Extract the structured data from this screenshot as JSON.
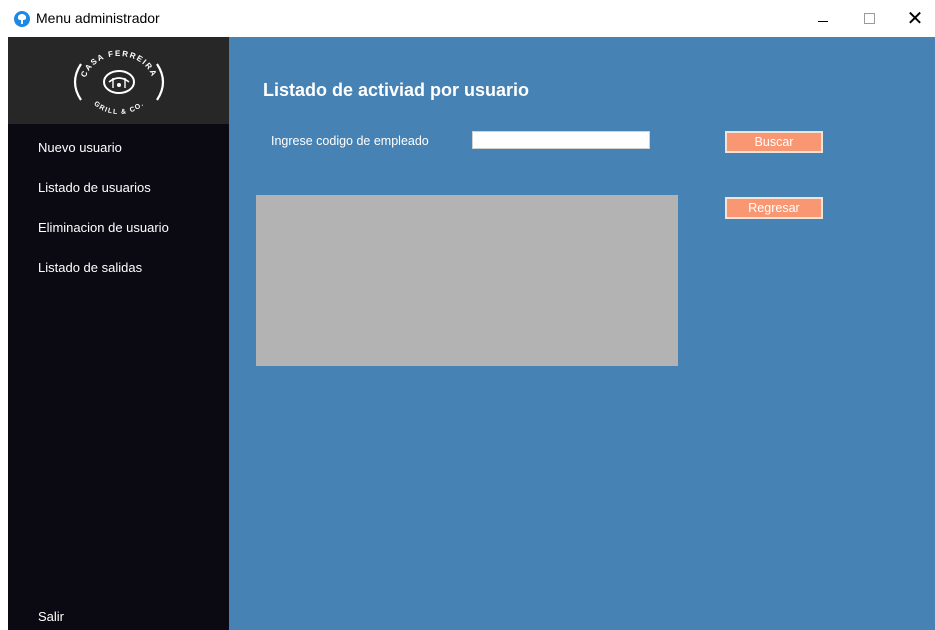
{
  "window": {
    "title": "Menu administrador",
    "icon": "app-icon"
  },
  "sidebar": {
    "logo": {
      "top_text": "CASA FERREIRA",
      "bottom_text": "GRILL & CO."
    },
    "items": [
      {
        "label": "Nuevo usuario"
      },
      {
        "label": "Listado de usuarios"
      },
      {
        "label": "Eliminacion de usuario"
      },
      {
        "label": "Listado de salidas"
      }
    ],
    "exit_label": "Salir"
  },
  "main": {
    "title": "Listado de activiad por usuario",
    "employee_label": "Ingrese codigo de empleado",
    "employee_input_value": "",
    "search_label": "Buscar",
    "back_label": "Regresar"
  },
  "colors": {
    "sidebar_bg": "#0b0a12",
    "logo_bg": "#272727",
    "main_bg": "#4682b4",
    "button_bg": "#fa9773",
    "grid_bg": "#b3b3b3"
  }
}
